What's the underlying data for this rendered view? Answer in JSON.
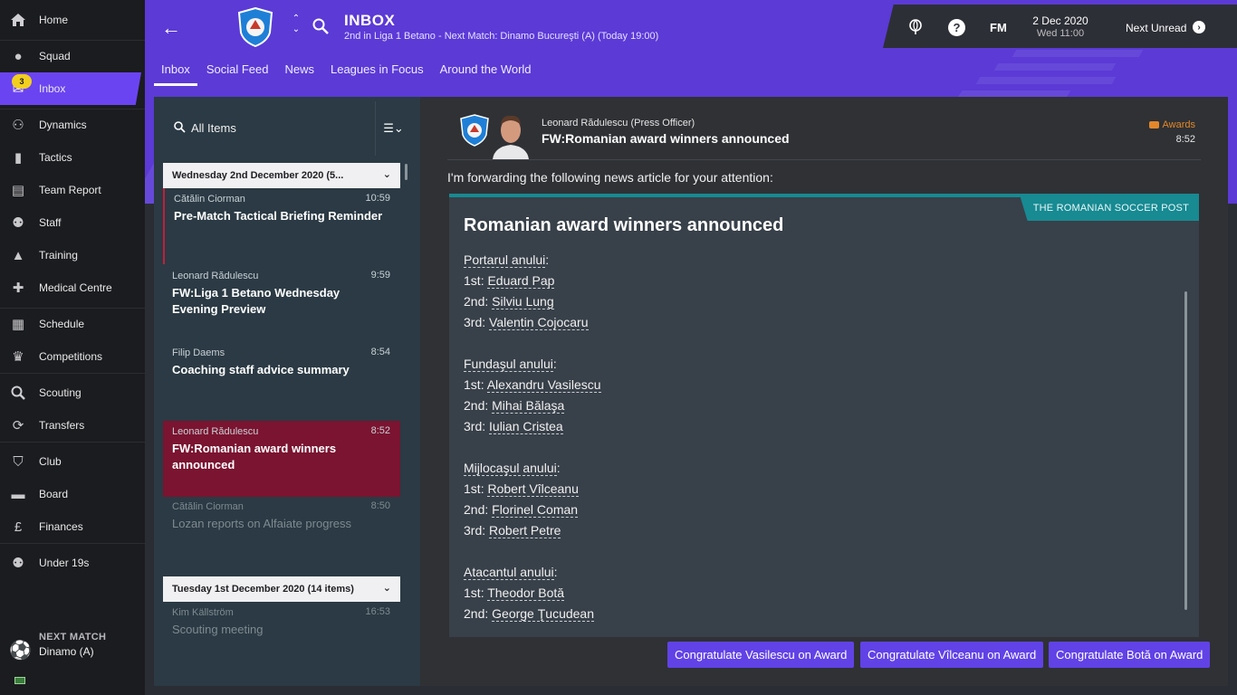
{
  "sidebar": {
    "items": [
      {
        "label": "Home",
        "icon": "home-icon"
      },
      {
        "label": "Squad",
        "icon": "squad-icon"
      },
      {
        "label": "Inbox",
        "icon": "inbox-icon",
        "badge": "3"
      },
      {
        "label": "Dynamics",
        "icon": "dynamics-icon"
      },
      {
        "label": "Tactics",
        "icon": "tactics-icon"
      },
      {
        "label": "Team Report",
        "icon": "report-icon"
      },
      {
        "label": "Staff",
        "icon": "staff-icon"
      },
      {
        "label": "Training",
        "icon": "training-icon"
      },
      {
        "label": "Medical Centre",
        "icon": "medical-icon"
      },
      {
        "label": "Schedule",
        "icon": "calendar-icon"
      },
      {
        "label": "Competitions",
        "icon": "trophy-icon"
      },
      {
        "label": "Scouting",
        "icon": "search-icon"
      },
      {
        "label": "Transfers",
        "icon": "transfer-icon"
      },
      {
        "label": "Club",
        "icon": "shield-icon"
      },
      {
        "label": "Board",
        "icon": "briefcase-icon"
      },
      {
        "label": "Finances",
        "icon": "money-icon"
      },
      {
        "label": "Under 19s",
        "icon": "u19-icon"
      }
    ],
    "next_match_title": "NEXT MATCH",
    "next_match_opponent": "Dinamo (A)"
  },
  "header": {
    "title": "INBOX",
    "subtitle": "2nd in Liga 1 Betano - Next Match: Dinamo Bucureşti (A) (Today 19:00)",
    "tabs": [
      "Inbox",
      "Social Feed",
      "News",
      "Leagues in Focus",
      "Around the World"
    ],
    "active_tab": "Inbox",
    "brand_color": "#5b3ad6"
  },
  "topbar": {
    "fm_label": "FM",
    "date": "2 Dec 2020",
    "day_time": "Wed 11:00",
    "next_unread": "Next Unread"
  },
  "inbox_list": {
    "search_placeholder": "All Items",
    "groups": [
      {
        "title": "Wednesday 2nd December 2020 (5...",
        "messages": [
          {
            "from": "Cătălin Ciorman",
            "time": "10:59",
            "subject": "Pre-Match Tactical Briefing Reminder",
            "read": false
          },
          {
            "from": "Leonard Rădulescu",
            "time": "9:59",
            "subject": "FW:Liga 1 Betano Wednesday Evening Preview",
            "read": false
          },
          {
            "from": "Filip Daems",
            "time": "8:54",
            "subject": "Coaching staff advice summary",
            "read": false
          },
          {
            "from": "Leonard Rădulescu",
            "time": "8:52",
            "subject": "FW:Romanian award winners announced",
            "read": false,
            "selected": true
          },
          {
            "from": "Cătălin Ciorman",
            "time": "8:50",
            "subject": "Lozan reports on Alfaiate progress",
            "read": true
          }
        ]
      },
      {
        "title": "Tuesday 1st December 2020 (14 items)",
        "messages": [
          {
            "from": "Kim Källström",
            "time": "16:53",
            "subject": "Scouting meeting",
            "read": true
          }
        ]
      }
    ]
  },
  "message": {
    "from": "Leonard Rădulescu  (Press Officer)",
    "subject": "FW:Romanian award winners announced",
    "tag": "Awards",
    "tag_color": "#e3882a",
    "time": "8:52",
    "intro": "I'm forwarding the following news article for your attention:",
    "article": {
      "source": "THE ROMANIAN SOCCER POST",
      "title": "Romanian award winners announced",
      "sections": [
        {
          "heading": "Portarul anului",
          "winners": [
            {
              "rank": "1st",
              "name": "Eduard Pap"
            },
            {
              "rank": "2nd",
              "name": "Silviu Lung"
            },
            {
              "rank": "3rd",
              "name": "Valentin Cojocaru"
            }
          ]
        },
        {
          "heading": "Fundaşul anului",
          "winners": [
            {
              "rank": "1st",
              "name": "Alexandru Vasilescu"
            },
            {
              "rank": "2nd",
              "name": "Mihai Bălaşa"
            },
            {
              "rank": "3rd",
              "name": "Iulian Cristea"
            }
          ]
        },
        {
          "heading": "Mijlocaşul anului",
          "winners": [
            {
              "rank": "1st",
              "name": "Robert Vîlceanu"
            },
            {
              "rank": "2nd",
              "name": "Florinel Coman"
            },
            {
              "rank": "3rd",
              "name": "Robert Petre"
            }
          ]
        },
        {
          "heading": "Atacantul anului",
          "winners": [
            {
              "rank": "1st",
              "name": "Theodor Botă"
            },
            {
              "rank": "2nd",
              "name": "George Ţucudean"
            }
          ]
        }
      ],
      "accent": "#178a92"
    },
    "actions": [
      "Congratulate Vasilescu on Award",
      "Congratulate Vîlceanu on Award",
      "Congratulate Botă on Award"
    ]
  }
}
